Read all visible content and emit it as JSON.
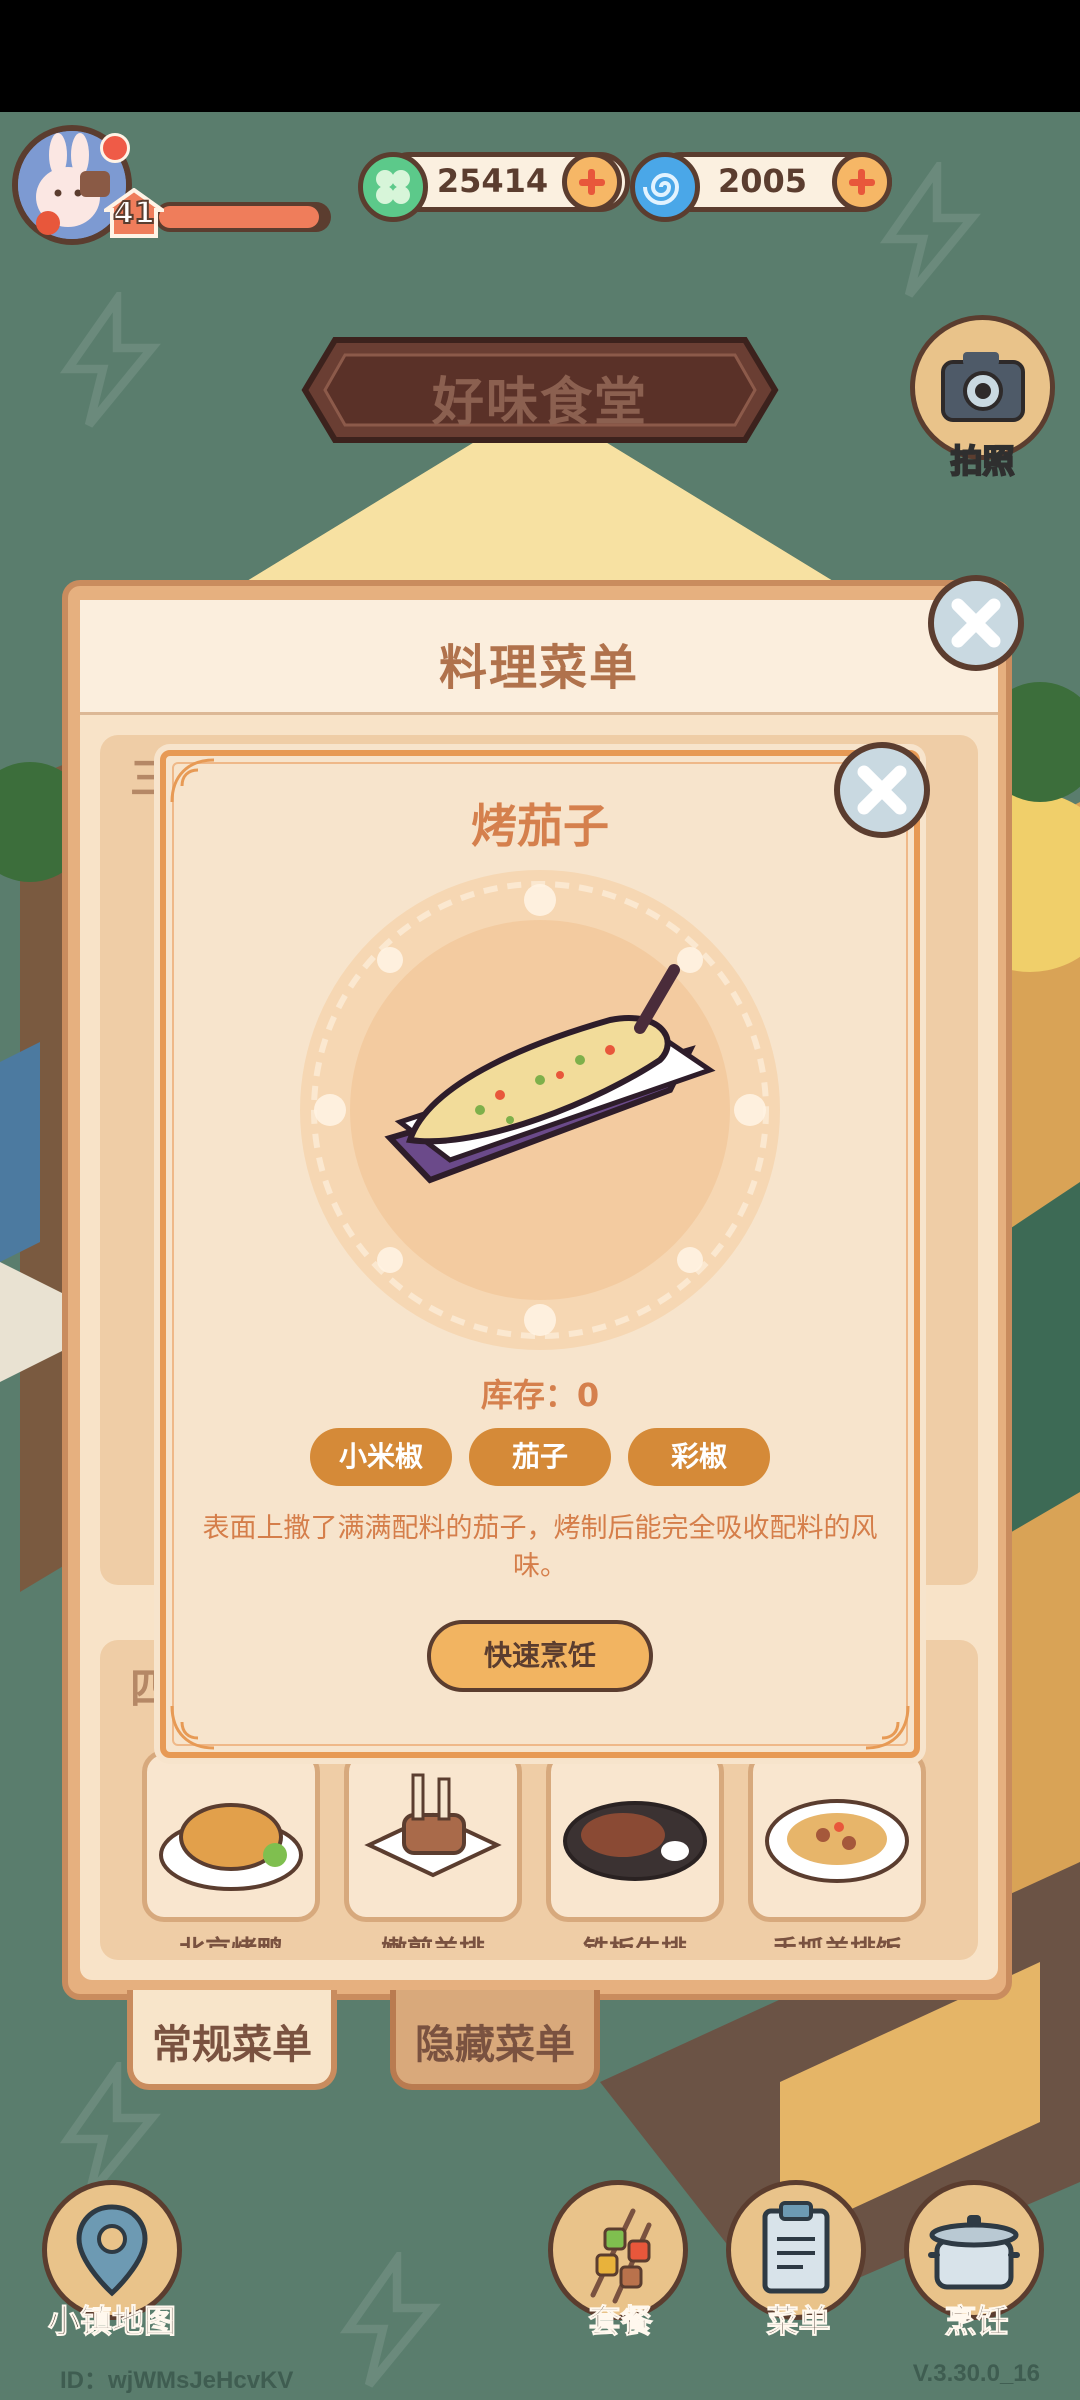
{
  "hud": {
    "level": "41",
    "xp_fraction": 0.95,
    "currencies": [
      {
        "name": "clover-coin",
        "value": "25414",
        "color": "#5cc98a"
      },
      {
        "name": "swirl-gem",
        "value": "2005",
        "color": "#4aa7e8"
      }
    ]
  },
  "restaurant_sign": "好味食堂",
  "camera_label": "拍照",
  "menu_panel": {
    "title": "料理菜单",
    "section_labels": [
      "三",
      "四"
    ],
    "dishes_row": [
      {
        "name": "北京烤鸭",
        "icon": "roast-duck"
      },
      {
        "name": "嫩煎羊排",
        "icon": "lamb-chops"
      },
      {
        "name": "铁板牛排",
        "icon": "steak"
      },
      {
        "name": "手抓羊排饭",
        "icon": "lamb-rice"
      }
    ],
    "tabs": [
      {
        "label": "常规菜单",
        "active": true
      },
      {
        "label": "隐藏菜单",
        "active": false
      }
    ]
  },
  "detail": {
    "title": "烤茄子",
    "image": "grilled-eggplant",
    "stock_label": "库存：",
    "stock_value": "0",
    "ingredients": [
      "小米椒",
      "茄子",
      "彩椒"
    ],
    "description": "表面上撒了满满配料的茄子，烤制后能完全吸收配料的风味。",
    "cook_button": "快速烹饪"
  },
  "bottom_nav": [
    {
      "label": "小镇地图",
      "icon": "map-pin-icon"
    },
    {
      "label": "套餐",
      "icon": "skewer-icon"
    },
    {
      "label": "菜单",
      "icon": "clipboard-icon"
    },
    {
      "label": "烹饪",
      "icon": "pot-icon"
    }
  ],
  "footer": {
    "id_text": "ID：wjWMsJeHcvKV",
    "version": "V.3.30.0_16"
  },
  "colors": {
    "background": "#5a7d6d",
    "panel_border": "#c98c5e",
    "accent_orange": "#d58a38",
    "text_brown": "#5b3d2f"
  }
}
